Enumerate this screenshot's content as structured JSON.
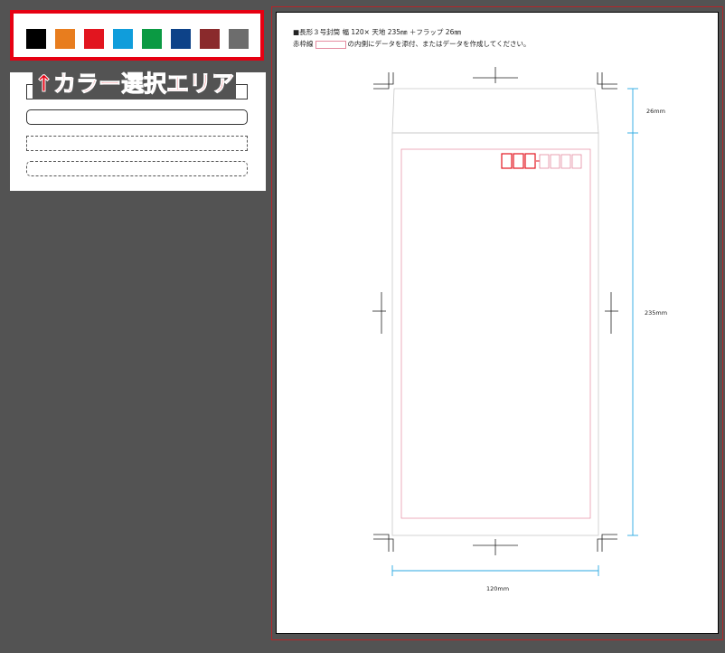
{
  "palette": {
    "colors": [
      "#000000",
      "#e87d1e",
      "#e2151f",
      "#109ddb",
      "#0b9a43",
      "#0d4288",
      "#8a2a2c",
      "#6d6d6d"
    ],
    "names": [
      "black-swatch",
      "orange-swatch",
      "red-swatch",
      "cyan-swatch",
      "green-swatch",
      "navy-swatch",
      "maroon-swatch",
      "gray-swatch"
    ]
  },
  "caption": {
    "arrow": "↑",
    "text": "カラー選択エリア"
  },
  "line_styles": [
    {
      "name": "line-style-solid-square",
      "border": "solid",
      "radius": "square"
    },
    {
      "name": "line-style-solid-rounded",
      "border": "solid",
      "radius": "rounded"
    },
    {
      "name": "line-style-dashed-square",
      "border": "dashed",
      "radius": "square"
    },
    {
      "name": "line-style-dashed-rounded",
      "border": "dashed",
      "radius": "rounded"
    }
  ],
  "template": {
    "spec_line1": "■長形３号封筒  幅 120×  天地 235㎜    ＋フラップ 26㎜",
    "spec_line2_prefix": "赤枠線",
    "spec_line2_suffix": "の内側にデータを添付、またはデータを作成してください。",
    "dim_flap": "26mm",
    "dim_height": "235mm",
    "dim_width": "120mm"
  },
  "colors": {
    "accent_red": "#e60012",
    "guide_cyan": "#29a7e1",
    "trim_pink": "#e58ba0"
  }
}
